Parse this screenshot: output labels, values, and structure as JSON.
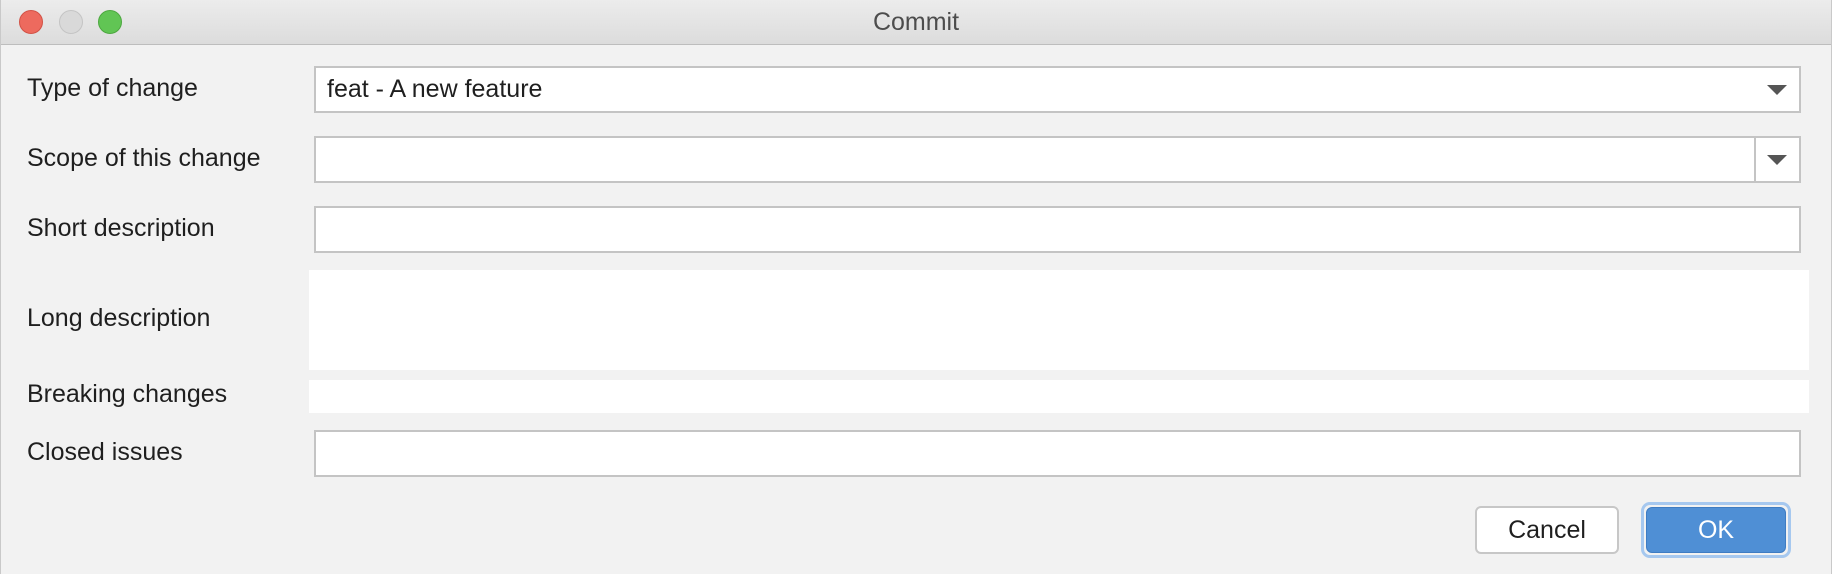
{
  "window": {
    "title": "Commit"
  },
  "form": {
    "type_of_change": {
      "label": "Type of change",
      "value": "feat - A new feature"
    },
    "scope": {
      "label": "Scope of this change",
      "value": ""
    },
    "short_description": {
      "label": "Short description",
      "value": ""
    },
    "long_description": {
      "label": "Long description",
      "value": ""
    },
    "breaking_changes": {
      "label": "Breaking changes",
      "value": ""
    },
    "closed_issues": {
      "label": "Closed issues",
      "value": ""
    }
  },
  "buttons": {
    "cancel": "Cancel",
    "ok": "OK"
  },
  "colors": {
    "accent": "#4f8fd5",
    "close": "#ed6a5e",
    "zoom": "#61c554"
  }
}
